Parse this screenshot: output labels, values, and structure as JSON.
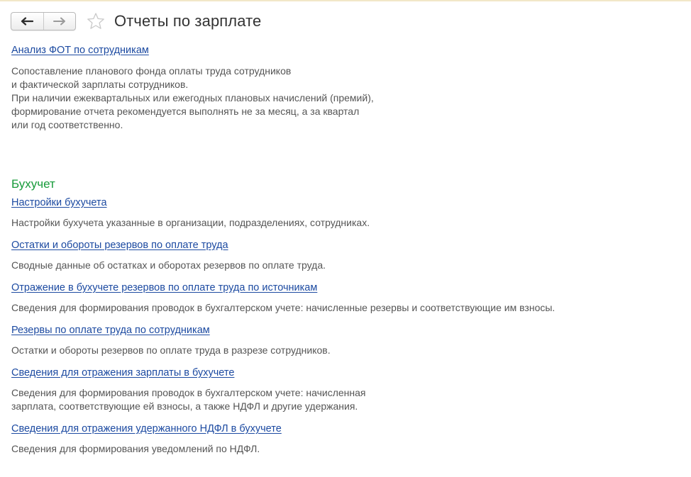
{
  "header": {
    "back_icon": "arrow-left-icon",
    "forward_icon": "arrow-right-icon",
    "favorite_icon": "star-icon",
    "title": "Отчеты по зарплате"
  },
  "top_report": {
    "link": "Анализ ФОТ по сотрудникам",
    "description": "Сопоставление планового фонда оплаты труда сотрудников\nи фактической зарплаты сотрудников.\nПри наличии ежеквартальных или ежегодных плановых начислений (премий),\nформирование отчета рекомендуется выполнять не за месяц, а за квартал\nили год соответственно."
  },
  "section": {
    "title": "Бухучет",
    "items": [
      {
        "link": "Настройки бухучета",
        "description": "Настройки бухучета указанные в организации, подразделениях, сотрудниках."
      },
      {
        "link": "Остатки и обороты резервов по оплате труда",
        "description": "Сводные данные об остатках и оборотах резервов по оплате труда."
      },
      {
        "link": "Отражение в бухучете резервов по оплате труда по источникам",
        "description": "Сведения для формирования проводок в бухгалтерском учете: начисленные резервы и соответствующие им взносы."
      },
      {
        "link": "Резервы по оплате труда по сотрудникам",
        "description": "Остатки и обороты резервов по оплате труда в разрезе сотрудников."
      },
      {
        "link": "Сведения для отражения зарплаты в бухучете",
        "description": "Сведения для формирования проводок в бухгалтерском учете: начисленная\nзарплата, соответствующие ей взносы, а также НДФЛ и другие удержания."
      },
      {
        "link": "Сведения для отражения удержанного НДФЛ в бухучете",
        "description": "Сведения для формирования уведомлений по НДФЛ."
      }
    ]
  },
  "colors": {
    "link": "#1c4aa1",
    "section_title": "#179b3a",
    "description": "#555555"
  }
}
